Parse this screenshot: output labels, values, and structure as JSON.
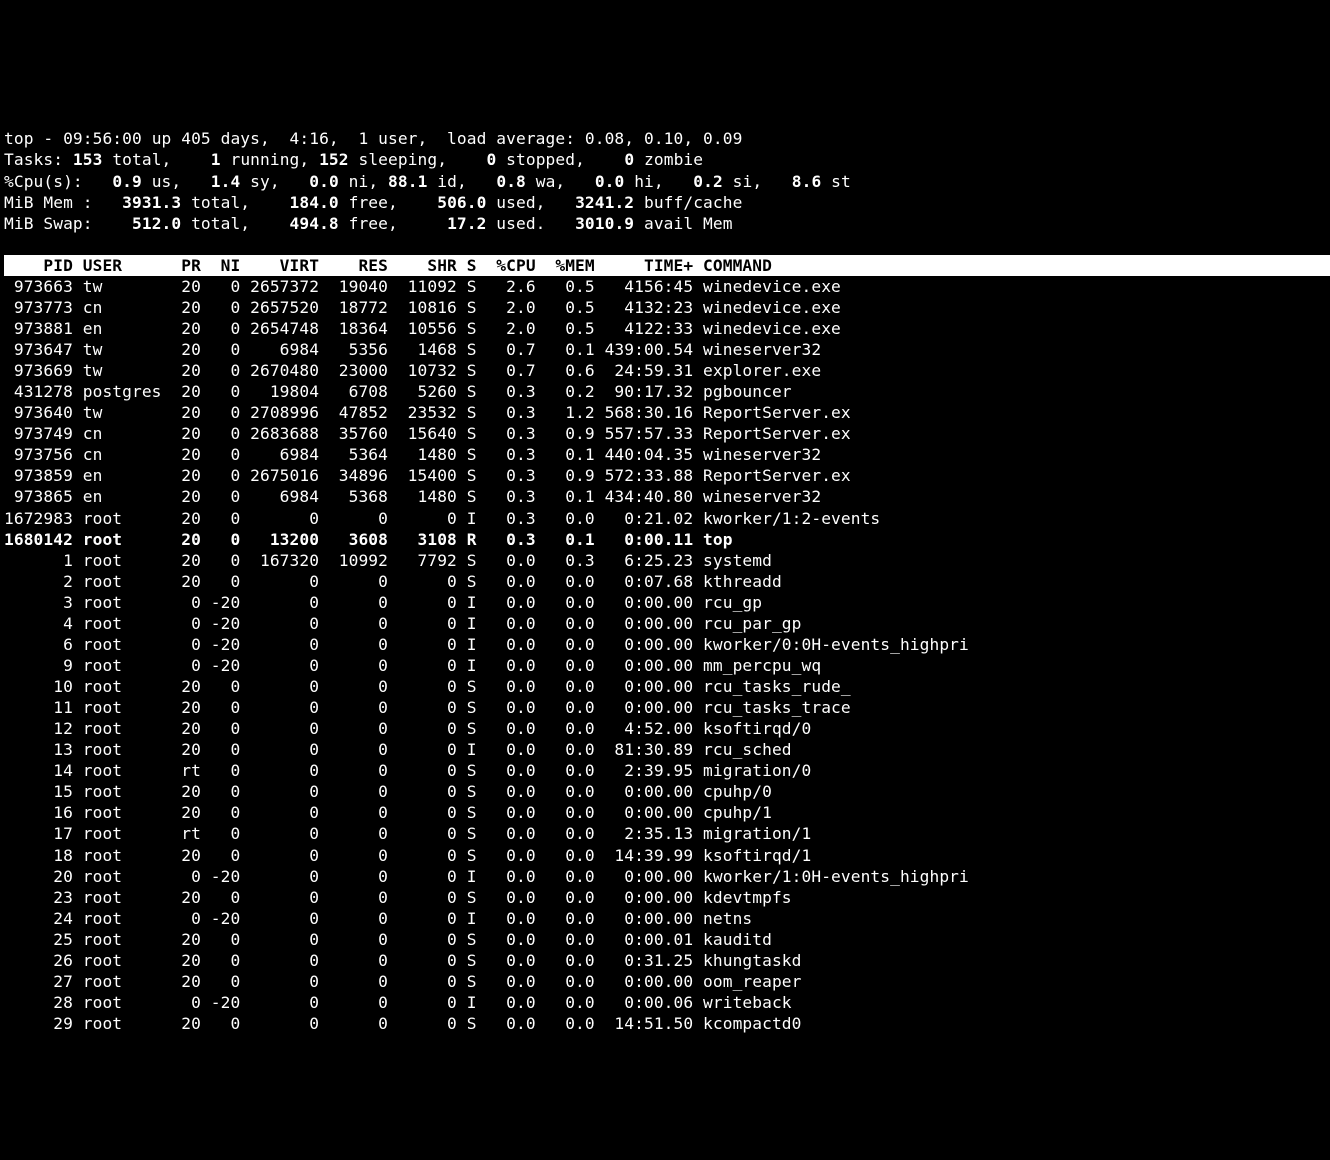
{
  "summary": {
    "line1_pre": "top - ",
    "time": "09:56:00",
    "line1_mid": " up 405 days,  4:16,  1 user,  load average: 0.08, 0.10, 0.09",
    "tasks_lbl": "Tasks:",
    "tasks_total": " 153 ",
    "tasks_total_s": "total,  ",
    "tasks_run": "  1 ",
    "tasks_run_s": "running,",
    "tasks_sleep": " 152 ",
    "tasks_sleep_s": "sleeping,  ",
    "tasks_stop": "  0 ",
    "tasks_stop_s": "stopped,  ",
    "tasks_zom": "  0 ",
    "tasks_zom_s": "zombie",
    "cpu_lbl": "%Cpu(s): ",
    "cpu_us": "  0.9 ",
    "cpu_us_s": "us, ",
    "cpu_sy": "  1.4 ",
    "cpu_sy_s": "sy, ",
    "cpu_ni": "  0.0 ",
    "cpu_ni_s": "ni,",
    "cpu_id": " 88.1 ",
    "cpu_id_s": "id, ",
    "cpu_wa": "  0.8 ",
    "cpu_wa_s": "wa, ",
    "cpu_hi": "  0.0 ",
    "cpu_hi_s": "hi, ",
    "cpu_si": "  0.2 ",
    "cpu_si_s": "si, ",
    "cpu_st": "  8.6 ",
    "cpu_st_s": "st",
    "mem_lbl": "MiB Mem :  ",
    "mem_total": " 3931.3 ",
    "mem_total_s": "total,  ",
    "mem_free": "  184.0 ",
    "mem_free_s": "free,  ",
    "mem_used": "  506.0 ",
    "mem_used_s": "used,  ",
    "mem_buff": " 3241.2 ",
    "mem_buff_s": "buff/cache",
    "swap_lbl": "MiB Swap:  ",
    "swap_total": "  512.0 ",
    "swap_total_s": "total,  ",
    "swap_free": "  494.8 ",
    "swap_free_s": "free,  ",
    "swap_used": "   17.2 ",
    "swap_used_s": "used.  ",
    "swap_avail": " 3010.9 ",
    "swap_avail_s": "avail Mem"
  },
  "header": "    PID USER      PR  NI    VIRT    RES    SHR S  %CPU  %MEM     TIME+ COMMAND",
  "rows": [
    {
      "pid": " 973663",
      "user": "tw      ",
      "pr": "20",
      "ni": "  0",
      "virt": "2657372",
      "res": " 19040",
      "shr": " 11092",
      "s": "S",
      "cpu": "  2.6",
      "mem": "  0.5",
      "time": "  4156:45",
      "cmd": "winedevice.exe"
    },
    {
      "pid": " 973773",
      "user": "cn      ",
      "pr": "20",
      "ni": "  0",
      "virt": "2657520",
      "res": " 18772",
      "shr": " 10816",
      "s": "S",
      "cpu": "  2.0",
      "mem": "  0.5",
      "time": "  4132:23",
      "cmd": "winedevice.exe"
    },
    {
      "pid": " 973881",
      "user": "en      ",
      "pr": "20",
      "ni": "  0",
      "virt": "2654748",
      "res": " 18364",
      "shr": " 10556",
      "s": "S",
      "cpu": "  2.0",
      "mem": "  0.5",
      "time": "  4122:33",
      "cmd": "winedevice.exe"
    },
    {
      "pid": " 973647",
      "user": "tw      ",
      "pr": "20",
      "ni": "  0",
      "virt": "   6984",
      "res": "  5356",
      "shr": "  1468",
      "s": "S",
      "cpu": "  0.7",
      "mem": "  0.1",
      "time": "439:00.54",
      "cmd": "wineserver32"
    },
    {
      "pid": " 973669",
      "user": "tw      ",
      "pr": "20",
      "ni": "  0",
      "virt": "2670480",
      "res": " 23000",
      "shr": " 10732",
      "s": "S",
      "cpu": "  0.7",
      "mem": "  0.6",
      "time": " 24:59.31",
      "cmd": "explorer.exe"
    },
    {
      "pid": " 431278",
      "user": "postgres",
      "pr": "20",
      "ni": "  0",
      "virt": "  19804",
      "res": "  6708",
      "shr": "  5260",
      "s": "S",
      "cpu": "  0.3",
      "mem": "  0.2",
      "time": " 90:17.32",
      "cmd": "pgbouncer"
    },
    {
      "pid": " 973640",
      "user": "tw      ",
      "pr": "20",
      "ni": "  0",
      "virt": "2708996",
      "res": " 47852",
      "shr": " 23532",
      "s": "S",
      "cpu": "  0.3",
      "mem": "  1.2",
      "time": "568:30.16",
      "cmd": "ReportServer.ex"
    },
    {
      "pid": " 973749",
      "user": "cn      ",
      "pr": "20",
      "ni": "  0",
      "virt": "2683688",
      "res": " 35760",
      "shr": " 15640",
      "s": "S",
      "cpu": "  0.3",
      "mem": "  0.9",
      "time": "557:57.33",
      "cmd": "ReportServer.ex"
    },
    {
      "pid": " 973756",
      "user": "cn      ",
      "pr": "20",
      "ni": "  0",
      "virt": "   6984",
      "res": "  5364",
      "shr": "  1480",
      "s": "S",
      "cpu": "  0.3",
      "mem": "  0.1",
      "time": "440:04.35",
      "cmd": "wineserver32"
    },
    {
      "pid": " 973859",
      "user": "en      ",
      "pr": "20",
      "ni": "  0",
      "virt": "2675016",
      "res": " 34896",
      "shr": " 15400",
      "s": "S",
      "cpu": "  0.3",
      "mem": "  0.9",
      "time": "572:33.88",
      "cmd": "ReportServer.ex"
    },
    {
      "pid": " 973865",
      "user": "en      ",
      "pr": "20",
      "ni": "  0",
      "virt": "   6984",
      "res": "  5368",
      "shr": "  1480",
      "s": "S",
      "cpu": "  0.3",
      "mem": "  0.1",
      "time": "434:40.80",
      "cmd": "wineserver32"
    },
    {
      "pid": "1672983",
      "user": "root    ",
      "pr": "20",
      "ni": "  0",
      "virt": "      0",
      "res": "     0",
      "shr": "     0",
      "s": "I",
      "cpu": "  0.3",
      "mem": "  0.0",
      "time": "  0:21.02",
      "cmd": "kworker/1:2-events"
    },
    {
      "pid": "1680142",
      "user": "root    ",
      "pr": "20",
      "ni": "  0",
      "virt": "  13200",
      "res": "  3608",
      "shr": "  3108",
      "s": "R",
      "cpu": "  0.3",
      "mem": "  0.1",
      "time": "  0:00.11",
      "cmd": "top",
      "hl": true
    },
    {
      "pid": "      1",
      "user": "root    ",
      "pr": "20",
      "ni": "  0",
      "virt": " 167320",
      "res": " 10992",
      "shr": "  7792",
      "s": "S",
      "cpu": "  0.0",
      "mem": "  0.3",
      "time": "  6:25.23",
      "cmd": "systemd"
    },
    {
      "pid": "      2",
      "user": "root    ",
      "pr": "20",
      "ni": "  0",
      "virt": "      0",
      "res": "     0",
      "shr": "     0",
      "s": "S",
      "cpu": "  0.0",
      "mem": "  0.0",
      "time": "  0:07.68",
      "cmd": "kthreadd"
    },
    {
      "pid": "      3",
      "user": "root    ",
      "pr": " 0",
      "ni": "-20",
      "virt": "      0",
      "res": "     0",
      "shr": "     0",
      "s": "I",
      "cpu": "  0.0",
      "mem": "  0.0",
      "time": "  0:00.00",
      "cmd": "rcu_gp"
    },
    {
      "pid": "      4",
      "user": "root    ",
      "pr": " 0",
      "ni": "-20",
      "virt": "      0",
      "res": "     0",
      "shr": "     0",
      "s": "I",
      "cpu": "  0.0",
      "mem": "  0.0",
      "time": "  0:00.00",
      "cmd": "rcu_par_gp"
    },
    {
      "pid": "      6",
      "user": "root    ",
      "pr": " 0",
      "ni": "-20",
      "virt": "      0",
      "res": "     0",
      "shr": "     0",
      "s": "I",
      "cpu": "  0.0",
      "mem": "  0.0",
      "time": "  0:00.00",
      "cmd": "kworker/0:0H-events_highpri"
    },
    {
      "pid": "      9",
      "user": "root    ",
      "pr": " 0",
      "ni": "-20",
      "virt": "      0",
      "res": "     0",
      "shr": "     0",
      "s": "I",
      "cpu": "  0.0",
      "mem": "  0.0",
      "time": "  0:00.00",
      "cmd": "mm_percpu_wq"
    },
    {
      "pid": "     10",
      "user": "root    ",
      "pr": "20",
      "ni": "  0",
      "virt": "      0",
      "res": "     0",
      "shr": "     0",
      "s": "S",
      "cpu": "  0.0",
      "mem": "  0.0",
      "time": "  0:00.00",
      "cmd": "rcu_tasks_rude_"
    },
    {
      "pid": "     11",
      "user": "root    ",
      "pr": "20",
      "ni": "  0",
      "virt": "      0",
      "res": "     0",
      "shr": "     0",
      "s": "S",
      "cpu": "  0.0",
      "mem": "  0.0",
      "time": "  0:00.00",
      "cmd": "rcu_tasks_trace"
    },
    {
      "pid": "     12",
      "user": "root    ",
      "pr": "20",
      "ni": "  0",
      "virt": "      0",
      "res": "     0",
      "shr": "     0",
      "s": "S",
      "cpu": "  0.0",
      "mem": "  0.0",
      "time": "  4:52.00",
      "cmd": "ksoftirqd/0"
    },
    {
      "pid": "     13",
      "user": "root    ",
      "pr": "20",
      "ni": "  0",
      "virt": "      0",
      "res": "     0",
      "shr": "     0",
      "s": "I",
      "cpu": "  0.0",
      "mem": "  0.0",
      "time": " 81:30.89",
      "cmd": "rcu_sched"
    },
    {
      "pid": "     14",
      "user": "root    ",
      "pr": "rt",
      "ni": "  0",
      "virt": "      0",
      "res": "     0",
      "shr": "     0",
      "s": "S",
      "cpu": "  0.0",
      "mem": "  0.0",
      "time": "  2:39.95",
      "cmd": "migration/0"
    },
    {
      "pid": "     15",
      "user": "root    ",
      "pr": "20",
      "ni": "  0",
      "virt": "      0",
      "res": "     0",
      "shr": "     0",
      "s": "S",
      "cpu": "  0.0",
      "mem": "  0.0",
      "time": "  0:00.00",
      "cmd": "cpuhp/0"
    },
    {
      "pid": "     16",
      "user": "root    ",
      "pr": "20",
      "ni": "  0",
      "virt": "      0",
      "res": "     0",
      "shr": "     0",
      "s": "S",
      "cpu": "  0.0",
      "mem": "  0.0",
      "time": "  0:00.00",
      "cmd": "cpuhp/1"
    },
    {
      "pid": "     17",
      "user": "root    ",
      "pr": "rt",
      "ni": "  0",
      "virt": "      0",
      "res": "     0",
      "shr": "     0",
      "s": "S",
      "cpu": "  0.0",
      "mem": "  0.0",
      "time": "  2:35.13",
      "cmd": "migration/1"
    },
    {
      "pid": "     18",
      "user": "root    ",
      "pr": "20",
      "ni": "  0",
      "virt": "      0",
      "res": "     0",
      "shr": "     0",
      "s": "S",
      "cpu": "  0.0",
      "mem": "  0.0",
      "time": " 14:39.99",
      "cmd": "ksoftirqd/1"
    },
    {
      "pid": "     20",
      "user": "root    ",
      "pr": " 0",
      "ni": "-20",
      "virt": "      0",
      "res": "     0",
      "shr": "     0",
      "s": "I",
      "cpu": "  0.0",
      "mem": "  0.0",
      "time": "  0:00.00",
      "cmd": "kworker/1:0H-events_highpri"
    },
    {
      "pid": "     23",
      "user": "root    ",
      "pr": "20",
      "ni": "  0",
      "virt": "      0",
      "res": "     0",
      "shr": "     0",
      "s": "S",
      "cpu": "  0.0",
      "mem": "  0.0",
      "time": "  0:00.00",
      "cmd": "kdevtmpfs"
    },
    {
      "pid": "     24",
      "user": "root    ",
      "pr": " 0",
      "ni": "-20",
      "virt": "      0",
      "res": "     0",
      "shr": "     0",
      "s": "I",
      "cpu": "  0.0",
      "mem": "  0.0",
      "time": "  0:00.00",
      "cmd": "netns"
    },
    {
      "pid": "     25",
      "user": "root    ",
      "pr": "20",
      "ni": "  0",
      "virt": "      0",
      "res": "     0",
      "shr": "     0",
      "s": "S",
      "cpu": "  0.0",
      "mem": "  0.0",
      "time": "  0:00.01",
      "cmd": "kauditd"
    },
    {
      "pid": "     26",
      "user": "root    ",
      "pr": "20",
      "ni": "  0",
      "virt": "      0",
      "res": "     0",
      "shr": "     0",
      "s": "S",
      "cpu": "  0.0",
      "mem": "  0.0",
      "time": "  0:31.25",
      "cmd": "khungtaskd"
    },
    {
      "pid": "     27",
      "user": "root    ",
      "pr": "20",
      "ni": "  0",
      "virt": "      0",
      "res": "     0",
      "shr": "     0",
      "s": "S",
      "cpu": "  0.0",
      "mem": "  0.0",
      "time": "  0:00.00",
      "cmd": "oom_reaper"
    },
    {
      "pid": "     28",
      "user": "root    ",
      "pr": " 0",
      "ni": "-20",
      "virt": "      0",
      "res": "     0",
      "shr": "     0",
      "s": "I",
      "cpu": "  0.0",
      "mem": "  0.0",
      "time": "  0:00.06",
      "cmd": "writeback"
    },
    {
      "pid": "     29",
      "user": "root    ",
      "pr": "20",
      "ni": "  0",
      "virt": "      0",
      "res": "     0",
      "shr": "     0",
      "s": "S",
      "cpu": "  0.0",
      "mem": "  0.0",
      "time": " 14:51.50",
      "cmd": "kcompactd0"
    }
  ]
}
